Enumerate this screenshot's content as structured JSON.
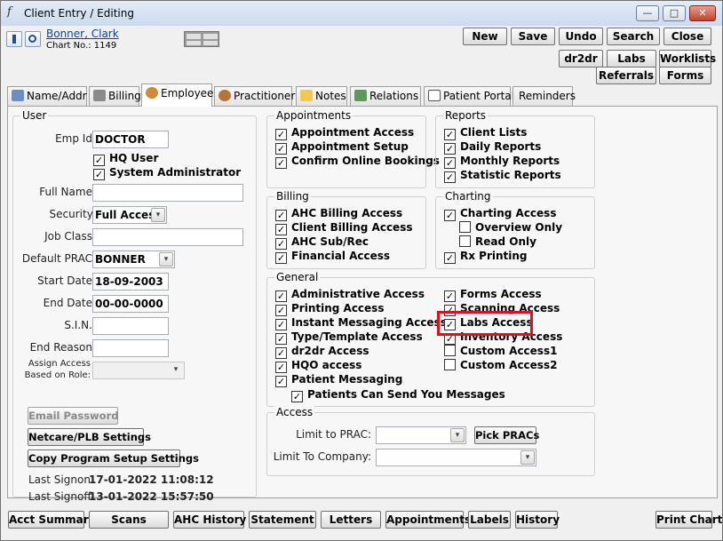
{
  "window": {
    "title": "Client Entry / Editing",
    "min": "—",
    "max": "□",
    "close": "✕"
  },
  "header": {
    "client_name": "Bonner, Clark",
    "chart_label": "Chart No.: 1149"
  },
  "toolbar": {
    "new": "New",
    "save": "Save",
    "undo": "Undo",
    "search": "Search",
    "close": "Close",
    "dr2dr": "dr2dr",
    "labs": "Labs",
    "worklists": "Worklists",
    "referrals": "Referrals",
    "forms": "Forms"
  },
  "tabs": [
    {
      "label": "Name/Addr"
    },
    {
      "label": "Billing"
    },
    {
      "label": "Employee"
    },
    {
      "label": "Practitioner"
    },
    {
      "label": "Notes"
    },
    {
      "label": "Relations"
    },
    {
      "label": "Patient Portal"
    },
    {
      "label": "Reminders"
    }
  ],
  "user": {
    "group_label": "User",
    "emp_id_label": "Emp Id:",
    "emp_id": "DOCTOR",
    "hq_user": "HQ User",
    "sys_admin": "System Administrator",
    "full_name_label": "Full Name:",
    "full_name": "",
    "security_label": "Security:",
    "security": "Full Access",
    "job_class_label": "Job Class:",
    "job_class": "",
    "default_prac_label": "Default PRAC:",
    "default_prac": "BONNER",
    "start_date_label": "Start Date:",
    "start_date": "18-09-2003",
    "end_date_label": "End Date:",
    "end_date": "00-00-0000",
    "sin_label": "S.I.N.:",
    "sin": "",
    "end_reason_label": "End Reason:",
    "end_reason": "",
    "assign_access_label1": "Assign Access",
    "assign_access_label2": "Based on Role:",
    "email_password": "Email Password",
    "netcare": "Netcare/PLB Settings",
    "copy_setup": "Copy Program Setup Settings",
    "last_signon_label": "Last Signon:",
    "last_signon": "17-01-2022 11:08:12",
    "last_signoff_label": "Last Signoff:",
    "last_signoff": "13-01-2022 15:57:50"
  },
  "appointments": {
    "label": "Appointments",
    "items": [
      "Appointment Access",
      "Appointment Setup",
      "Confirm Online Bookings"
    ]
  },
  "reports": {
    "label": "Reports",
    "items": [
      "Client Lists",
      "Daily Reports",
      "Monthly Reports",
      "Statistic Reports"
    ]
  },
  "billing": {
    "label": "Billing",
    "items": [
      "AHC Billing Access",
      "Client Billing Access",
      "AHC Sub/Rec",
      "Financial Access"
    ]
  },
  "charting": {
    "label": "Charting",
    "items": [
      "Charting Access",
      "Overview Only",
      "Read Only",
      "Rx Printing"
    ]
  },
  "general": {
    "label": "General",
    "left": [
      "Administrative Access",
      "Printing Access",
      "Instant Messaging Access",
      "Type/Template Access",
      "dr2dr Access",
      "HQO access",
      "Patient Messaging",
      "Patients Can Send You Messages"
    ],
    "right": [
      "Forms Access",
      "Scanning Access",
      "Labs Access",
      "Inventory Access",
      "Custom Access1",
      "Custom Access2"
    ]
  },
  "access": {
    "label": "Access",
    "limit_prac_label": "Limit to PRAC:",
    "limit_prac": "",
    "pick_pracs": "Pick PRACs",
    "limit_company_label": "Limit To Company:",
    "limit_company": ""
  },
  "bottom": {
    "acct_summary": "Acct Summary",
    "scans": "Scans",
    "ahc_history": "AHC History",
    "statement": "Statement",
    "letters": "Letters",
    "appointments": "Appointments",
    "labels": "Labels",
    "history": "History",
    "print_chart": "Print Chart"
  },
  "check": "✓"
}
